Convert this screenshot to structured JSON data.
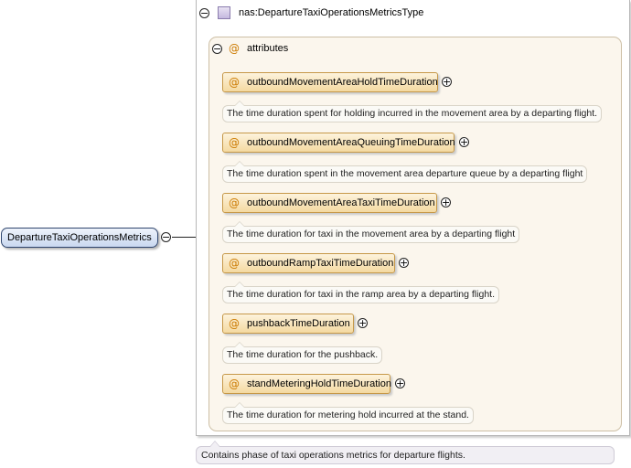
{
  "root_element": {
    "label": "DepartureTaxiOperationsMetrics"
  },
  "complex_type": {
    "title": "nas:DepartureTaxiOperationsMetricsType",
    "documentation": "Contains phase of taxi operations metrics for departure flights."
  },
  "attribute_group": {
    "label": "attributes",
    "symbol": "@"
  },
  "toggles": {
    "collapse": "−",
    "expand": "+"
  },
  "attributes": [
    {
      "name": "outboundMovementAreaHoldTimeDuration",
      "doc": "The time duration spent for holding incurred in the movement area by a departing flight."
    },
    {
      "name": "outboundMovementAreaQueuingTimeDuration",
      "doc": "The time duration spent in the movement area departure queue by a departing flight"
    },
    {
      "name": "outboundMovementAreaTaxiTimeDuration",
      "doc": "The time duration for taxi in the movement area by a departing flight"
    },
    {
      "name": "outboundRampTaxiTimeDuration",
      "doc": "The time duration for taxi in the ramp area by a departing flight."
    },
    {
      "name": "pushbackTimeDuration",
      "doc": "The time duration for the pushback."
    },
    {
      "name": "standMeteringHoldTimeDuration",
      "doc": "The time duration for metering hold incurred at the stand."
    }
  ],
  "colors": {
    "attribute_fill": "#f4d9a0",
    "attribute_border": "#c69848",
    "element_fill": "#c9d8f0",
    "element_border": "#30466e",
    "group_fill": "#fbf6ed",
    "at_symbol": "#cc7a00"
  }
}
